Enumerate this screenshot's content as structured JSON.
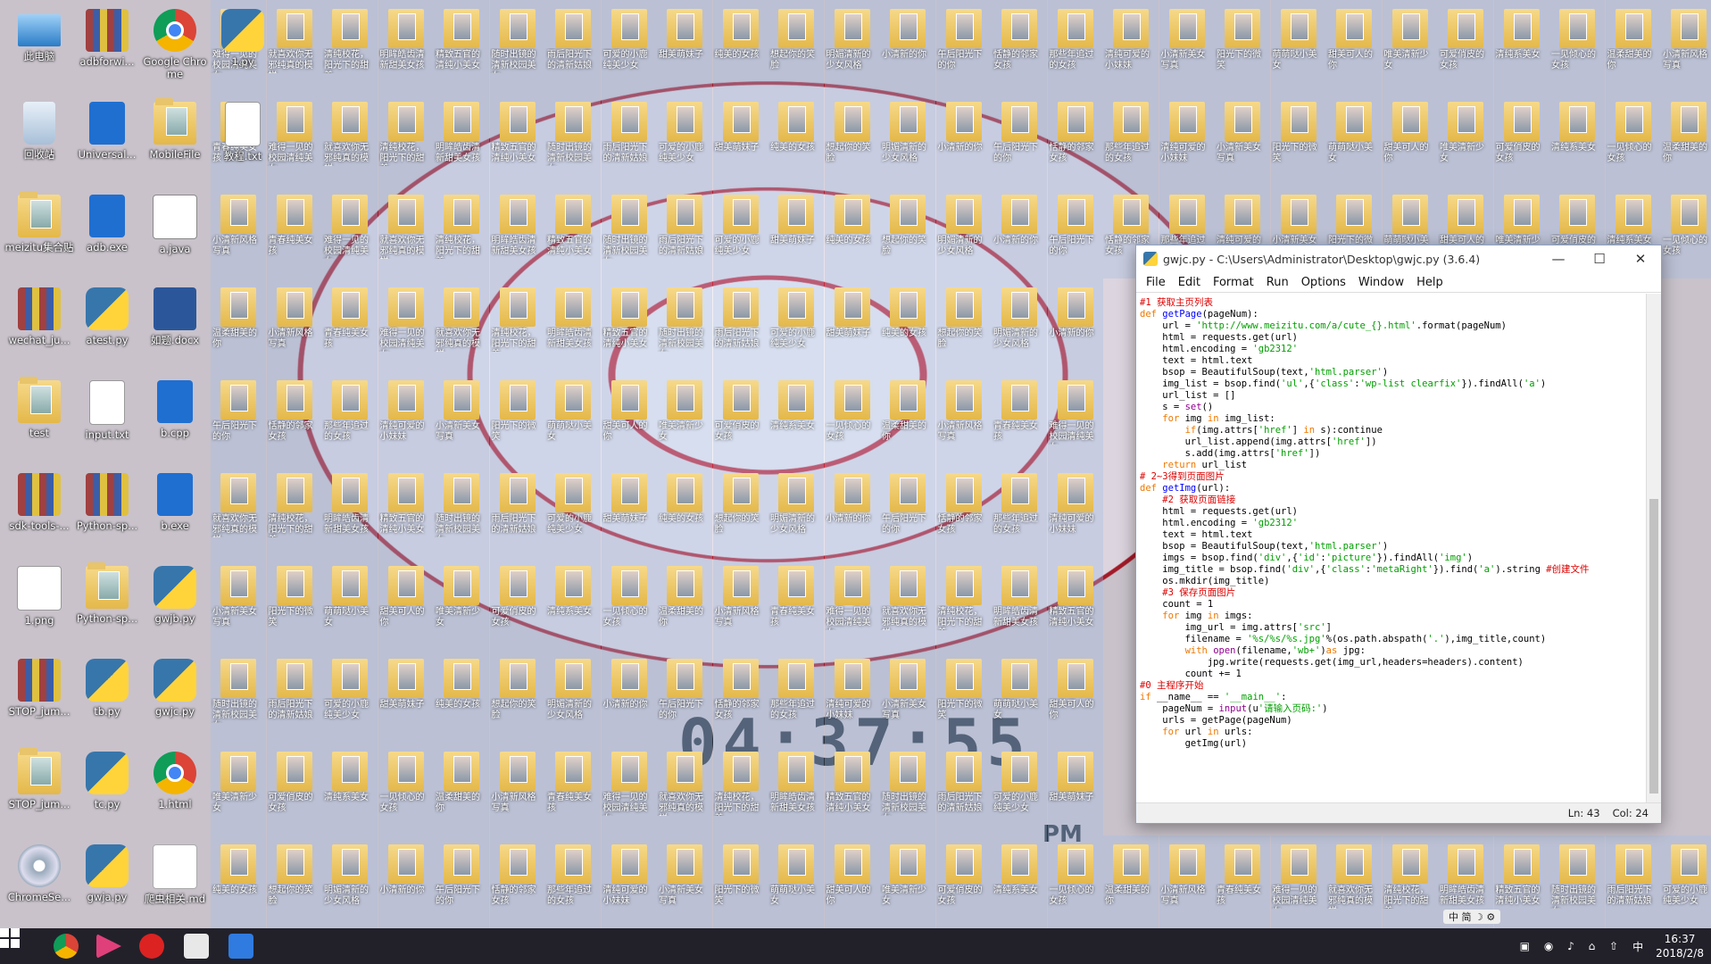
{
  "desktop": {
    "icons": [
      {
        "label": "此电脑",
        "type": "pc"
      },
      {
        "label": "adbforwi...",
        "type": "winrar"
      },
      {
        "label": "Google Chrome",
        "type": "chrome"
      },
      {
        "label": "1.py",
        "type": "python"
      },
      {
        "label": "回收站",
        "type": "bin"
      },
      {
        "label": "Universal...",
        "type": "exe"
      },
      {
        "label": "MobileFile",
        "type": "folder"
      },
      {
        "label": "教程.txt",
        "type": "txt"
      },
      {
        "label": "meizitu集合贴",
        "type": "folder"
      },
      {
        "label": "adb.exe",
        "type": "exe"
      },
      {
        "label": "a.java",
        "type": "java"
      },
      {
        "label": "wechat_ju...",
        "type": "winrar"
      },
      {
        "label": "atest.py",
        "type": "python"
      },
      {
        "label": "如题.docx",
        "type": "word"
      },
      {
        "label": "test",
        "type": "folder"
      },
      {
        "label": "input.txt",
        "type": "txt"
      },
      {
        "label": "b.cpp",
        "type": "exe"
      },
      {
        "label": "sdk-tools-...",
        "type": "winrar"
      },
      {
        "label": "Python-sp...",
        "type": "winrar"
      },
      {
        "label": "b.exe",
        "type": "exe"
      },
      {
        "label": "1.png",
        "type": "png"
      },
      {
        "label": "Python-sp...",
        "type": "folder"
      },
      {
        "label": "gwjb.py",
        "type": "python"
      },
      {
        "label": "STOP_jum...",
        "type": "winrar"
      },
      {
        "label": "tb.py",
        "type": "python"
      },
      {
        "label": "gwjc.py",
        "type": "python"
      },
      {
        "label": "STOP_jum...",
        "type": "folder"
      },
      {
        "label": "tc.py",
        "type": "python"
      },
      {
        "label": "1.html",
        "type": "chrome"
      },
      {
        "label": "ChromeSe...",
        "type": "disc"
      },
      {
        "label": "gwja.py",
        "type": "python"
      },
      {
        "label": "爬虫相关.md",
        "type": "md"
      }
    ],
    "folder_titles": [
      "难得一见的校园清纯美女",
      "就喜欢你无邪纯真的模样",
      "清纯校花，阳光下的甜美",
      "明眸皓齿清新甜美女孩",
      "精致五官的清纯小美女",
      "随时出镜的清新校园美女",
      "雨后阳光下的清新姑娘",
      "可爱的小鹿纯美少女",
      "甜美萌妹子",
      "纯美的女孩",
      "想起你的笑脸",
      "明媚清新的少女风格",
      "小清新的你",
      "午后阳光下的你",
      "恬静的邻家女孩",
      "那些年追过的女孩",
      "清纯可爱的小妹妹",
      "小清新美女写真",
      "阳光下的微笑",
      "萌萌哒小美女",
      "甜美可人的你",
      "唯美清新少女",
      "可爱俏皮的女孩",
      "清纯系美女",
      "一见倾心的女孩",
      "温柔甜美的你",
      "小清新风格写真",
      "青春纯美女孩"
    ],
    "wallpaper_clock": "04:37:55",
    "wallpaper_ampm": "PM"
  },
  "idle_window": {
    "title": "gwjc.py - C:\\Users\\Administrator\\Desktop\\gwjc.py (3.6.4)",
    "menus": [
      "File",
      "Edit",
      "Format",
      "Run",
      "Options",
      "Window",
      "Help"
    ],
    "code_lines": [
      "#1 获取主页列表",
      "def getPage(pageNum):",
      "    url = 'http://www.meizitu.com/a/cute_{}.html'.format(pageNum)",
      "    html = requests.get(url)",
      "    html.encoding = 'gb2312'",
      "    text = html.text",
      "    bsop = BeautifulSoup(text,'html.parser')",
      "    img_list = bsop.find('ul',{'class':'wp-list clearfix'}).findAll('a')",
      "    url_list = []",
      "    s = set()",
      "    for img in img_list:",
      "        if(img.attrs['href'] in s):continue",
      "        url_list.append(img.attrs['href'])",
      "        s.add(img.attrs['href'])",
      "    return url_list",
      "",
      "# 2~3得到页面图片",
      "def getImg(url):",
      "    #2 获取页面链接",
      "    html = requests.get(url)",
      "    html.encoding = 'gb2312'",
      "    text = html.text",
      "    bsop = BeautifulSoup(text,'html.parser')",
      "    imgs = bsop.find('div',{'id':'picture'}).findAll('img')",
      "    img_title = bsop.find('div',{'class':'metaRight'}).find('a').string #创建文件",
      "    os.mkdir(img_title)",
      "    #3 保存页面图片",
      "    count = 1",
      "    for img in imgs:",
      "        img_url = img.attrs['src']",
      "        filename = '%s/%s/%s.jpg'%(os.path.abspath('.'),img_title,count)",
      "        with open(filename,'wb+')as jpg:",
      "            jpg.write(requests.get(img_url,headers=headers).content)",
      "        count += 1",
      "",
      "#0 主程序开始",
      "if __name__ == '__main__':",
      "    pageNum = input(u'请输入页码:')",
      "    urls = getPage(pageNum)",
      "    for url in urls:",
      "        getImg(url)"
    ],
    "status_line": "Ln: 43",
    "status_col": "Col: 24"
  },
  "taskbar": {
    "time": "16:37",
    "date": "2018/2/8",
    "ime": "中",
    "float_bar": "中 简 ☽ ⚙"
  }
}
